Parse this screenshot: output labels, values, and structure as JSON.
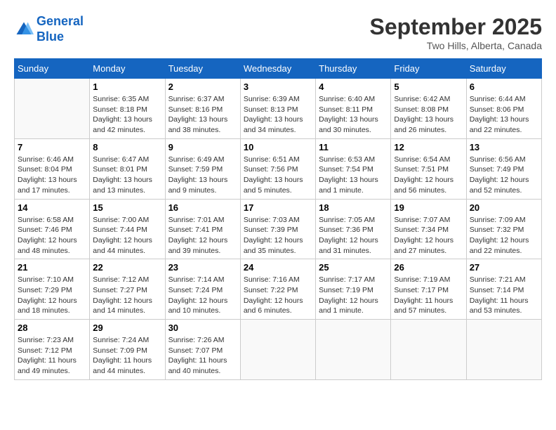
{
  "logo": {
    "line1": "General",
    "line2": "Blue"
  },
  "title": "September 2025",
  "subtitle": "Two Hills, Alberta, Canada",
  "days_of_week": [
    "Sunday",
    "Monday",
    "Tuesday",
    "Wednesday",
    "Thursday",
    "Friday",
    "Saturday"
  ],
  "weeks": [
    [
      {
        "day": "",
        "sunrise": "",
        "sunset": "",
        "daylight": ""
      },
      {
        "day": "1",
        "sunrise": "Sunrise: 6:35 AM",
        "sunset": "Sunset: 8:18 PM",
        "daylight": "Daylight: 13 hours and 42 minutes."
      },
      {
        "day": "2",
        "sunrise": "Sunrise: 6:37 AM",
        "sunset": "Sunset: 8:16 PM",
        "daylight": "Daylight: 13 hours and 38 minutes."
      },
      {
        "day": "3",
        "sunrise": "Sunrise: 6:39 AM",
        "sunset": "Sunset: 8:13 PM",
        "daylight": "Daylight: 13 hours and 34 minutes."
      },
      {
        "day": "4",
        "sunrise": "Sunrise: 6:40 AM",
        "sunset": "Sunset: 8:11 PM",
        "daylight": "Daylight: 13 hours and 30 minutes."
      },
      {
        "day": "5",
        "sunrise": "Sunrise: 6:42 AM",
        "sunset": "Sunset: 8:08 PM",
        "daylight": "Daylight: 13 hours and 26 minutes."
      },
      {
        "day": "6",
        "sunrise": "Sunrise: 6:44 AM",
        "sunset": "Sunset: 8:06 PM",
        "daylight": "Daylight: 13 hours and 22 minutes."
      }
    ],
    [
      {
        "day": "7",
        "sunrise": "Sunrise: 6:46 AM",
        "sunset": "Sunset: 8:04 PM",
        "daylight": "Daylight: 13 hours and 17 minutes."
      },
      {
        "day": "8",
        "sunrise": "Sunrise: 6:47 AM",
        "sunset": "Sunset: 8:01 PM",
        "daylight": "Daylight: 13 hours and 13 minutes."
      },
      {
        "day": "9",
        "sunrise": "Sunrise: 6:49 AM",
        "sunset": "Sunset: 7:59 PM",
        "daylight": "Daylight: 13 hours and 9 minutes."
      },
      {
        "day": "10",
        "sunrise": "Sunrise: 6:51 AM",
        "sunset": "Sunset: 7:56 PM",
        "daylight": "Daylight: 13 hours and 5 minutes."
      },
      {
        "day": "11",
        "sunrise": "Sunrise: 6:53 AM",
        "sunset": "Sunset: 7:54 PM",
        "daylight": "Daylight: 13 hours and 1 minute."
      },
      {
        "day": "12",
        "sunrise": "Sunrise: 6:54 AM",
        "sunset": "Sunset: 7:51 PM",
        "daylight": "Daylight: 12 hours and 56 minutes."
      },
      {
        "day": "13",
        "sunrise": "Sunrise: 6:56 AM",
        "sunset": "Sunset: 7:49 PM",
        "daylight": "Daylight: 12 hours and 52 minutes."
      }
    ],
    [
      {
        "day": "14",
        "sunrise": "Sunrise: 6:58 AM",
        "sunset": "Sunset: 7:46 PM",
        "daylight": "Daylight: 12 hours and 48 minutes."
      },
      {
        "day": "15",
        "sunrise": "Sunrise: 7:00 AM",
        "sunset": "Sunset: 7:44 PM",
        "daylight": "Daylight: 12 hours and 44 minutes."
      },
      {
        "day": "16",
        "sunrise": "Sunrise: 7:01 AM",
        "sunset": "Sunset: 7:41 PM",
        "daylight": "Daylight: 12 hours and 39 minutes."
      },
      {
        "day": "17",
        "sunrise": "Sunrise: 7:03 AM",
        "sunset": "Sunset: 7:39 PM",
        "daylight": "Daylight: 12 hours and 35 minutes."
      },
      {
        "day": "18",
        "sunrise": "Sunrise: 7:05 AM",
        "sunset": "Sunset: 7:36 PM",
        "daylight": "Daylight: 12 hours and 31 minutes."
      },
      {
        "day": "19",
        "sunrise": "Sunrise: 7:07 AM",
        "sunset": "Sunset: 7:34 PM",
        "daylight": "Daylight: 12 hours and 27 minutes."
      },
      {
        "day": "20",
        "sunrise": "Sunrise: 7:09 AM",
        "sunset": "Sunset: 7:32 PM",
        "daylight": "Daylight: 12 hours and 22 minutes."
      }
    ],
    [
      {
        "day": "21",
        "sunrise": "Sunrise: 7:10 AM",
        "sunset": "Sunset: 7:29 PM",
        "daylight": "Daylight: 12 hours and 18 minutes."
      },
      {
        "day": "22",
        "sunrise": "Sunrise: 7:12 AM",
        "sunset": "Sunset: 7:27 PM",
        "daylight": "Daylight: 12 hours and 14 minutes."
      },
      {
        "day": "23",
        "sunrise": "Sunrise: 7:14 AM",
        "sunset": "Sunset: 7:24 PM",
        "daylight": "Daylight: 12 hours and 10 minutes."
      },
      {
        "day": "24",
        "sunrise": "Sunrise: 7:16 AM",
        "sunset": "Sunset: 7:22 PM",
        "daylight": "Daylight: 12 hours and 6 minutes."
      },
      {
        "day": "25",
        "sunrise": "Sunrise: 7:17 AM",
        "sunset": "Sunset: 7:19 PM",
        "daylight": "Daylight: 12 hours and 1 minute."
      },
      {
        "day": "26",
        "sunrise": "Sunrise: 7:19 AM",
        "sunset": "Sunset: 7:17 PM",
        "daylight": "Daylight: 11 hours and 57 minutes."
      },
      {
        "day": "27",
        "sunrise": "Sunrise: 7:21 AM",
        "sunset": "Sunset: 7:14 PM",
        "daylight": "Daylight: 11 hours and 53 minutes."
      }
    ],
    [
      {
        "day": "28",
        "sunrise": "Sunrise: 7:23 AM",
        "sunset": "Sunset: 7:12 PM",
        "daylight": "Daylight: 11 hours and 49 minutes."
      },
      {
        "day": "29",
        "sunrise": "Sunrise: 7:24 AM",
        "sunset": "Sunset: 7:09 PM",
        "daylight": "Daylight: 11 hours and 44 minutes."
      },
      {
        "day": "30",
        "sunrise": "Sunrise: 7:26 AM",
        "sunset": "Sunset: 7:07 PM",
        "daylight": "Daylight: 11 hours and 40 minutes."
      },
      {
        "day": "",
        "sunrise": "",
        "sunset": "",
        "daylight": ""
      },
      {
        "day": "",
        "sunrise": "",
        "sunset": "",
        "daylight": ""
      },
      {
        "day": "",
        "sunrise": "",
        "sunset": "",
        "daylight": ""
      },
      {
        "day": "",
        "sunrise": "",
        "sunset": "",
        "daylight": ""
      }
    ]
  ]
}
